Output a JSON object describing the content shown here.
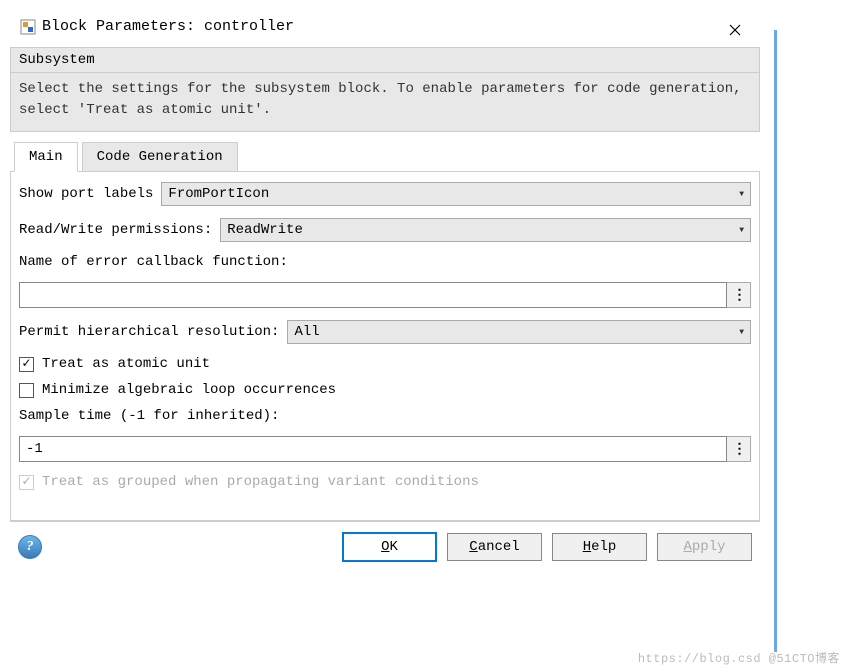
{
  "titlebar": {
    "title": "Block Parameters: controller"
  },
  "section": {
    "header": "Subsystem",
    "description": "Select the settings for the subsystem block. To enable parameters for code generation, select 'Treat as atomic unit'."
  },
  "tabs": {
    "main": "Main",
    "codegen": "Code Generation"
  },
  "fields": {
    "show_port_labels_label": "Show port labels",
    "show_port_labels_value": "FromPortIcon",
    "rw_perm_label": "Read/Write permissions:",
    "rw_perm_value": "ReadWrite",
    "error_cb_label": "Name of error callback function:",
    "error_cb_value": "",
    "hier_res_label": "Permit hierarchical resolution:",
    "hier_res_value": "All",
    "treat_atomic_label": "Treat as atomic unit",
    "minimize_loop_label": "Minimize algebraic loop occurrences",
    "sample_time_label": "Sample time (-1 for inherited):",
    "sample_time_value": "-1",
    "treat_grouped_label": "Treat as grouped when propagating variant conditions"
  },
  "buttons": {
    "ok": "OK",
    "cancel": "Cancel",
    "help": "Help",
    "apply": "Apply",
    "more": "⋮"
  },
  "watermark": "https://blog.csd @51CTO博客"
}
